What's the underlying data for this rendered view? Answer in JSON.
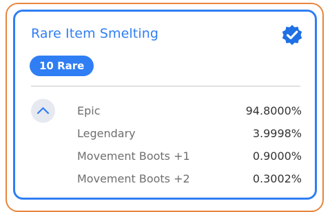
{
  "card": {
    "title": "Rare Item Smelting",
    "badge": "10 Rare",
    "verified_icon": "verified-badge-icon",
    "collapse_icon": "chevron-up-icon"
  },
  "colors": {
    "accent": "#2f7ef3",
    "outer_border": "#e8843c",
    "text_muted": "#6e6e6e",
    "text_value": "#333333",
    "button_bg": "#e6e9f0"
  },
  "outcomes": [
    {
      "name": "Epic",
      "percent": "94.8000%"
    },
    {
      "name": "Legendary",
      "percent": "3.9998%"
    },
    {
      "name": "Movement Boots +1",
      "percent": "0.9000%"
    },
    {
      "name": "Movement Boots +2",
      "percent": "0.3002%"
    }
  ]
}
